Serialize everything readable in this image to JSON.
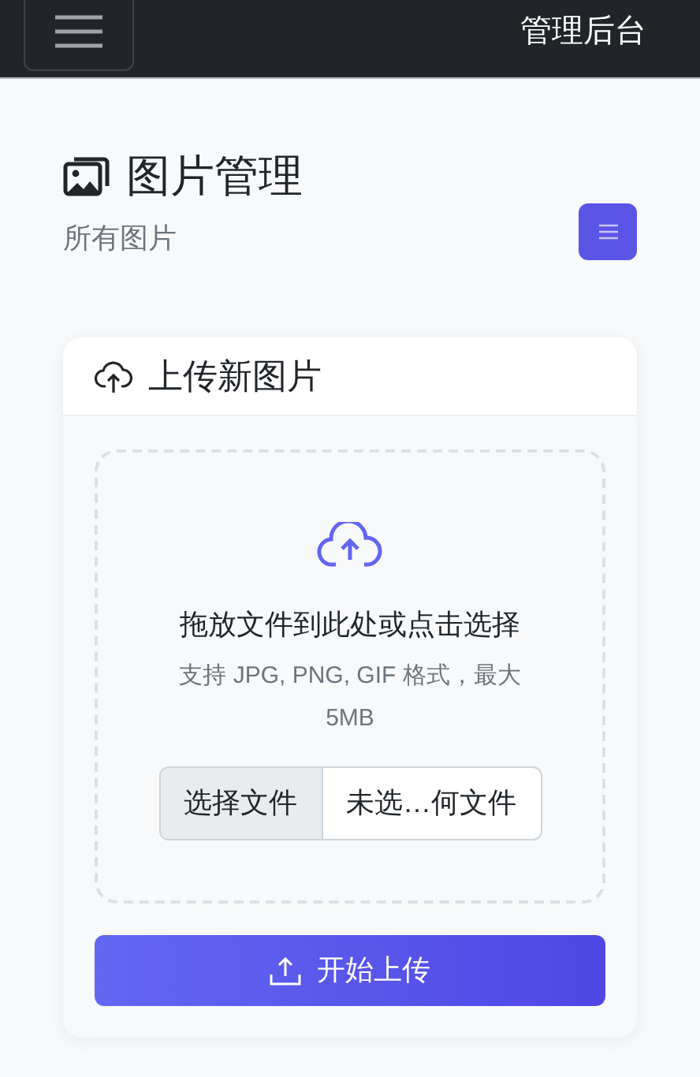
{
  "navbar": {
    "title": "管理后台"
  },
  "header": {
    "title": "图片管理",
    "subtitle": "所有图片"
  },
  "upload_card": {
    "title": "上传新图片",
    "dropzone": {
      "prompt": "拖放文件到此处或点击选择",
      "hint": "支持 JPG, PNG, GIF 格式，最大 5MB"
    },
    "file_input": {
      "button": "选择文件",
      "value": "未选…何文件"
    },
    "submit": "开始上传"
  }
}
